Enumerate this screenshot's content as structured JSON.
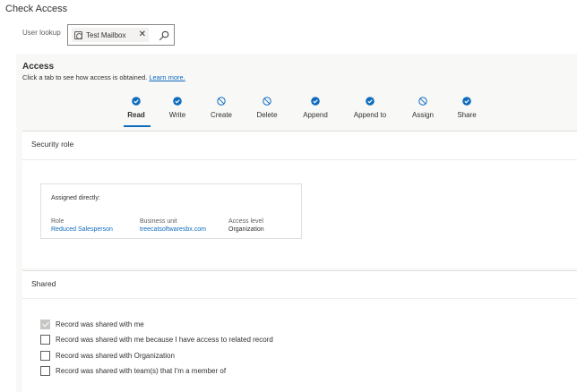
{
  "page_title": "Check Access",
  "user_lookup": {
    "label": "User lookup",
    "selected_value": "Test Mailbox",
    "clear_glyph": "✕",
    "chip_icon": "mailbox-icon",
    "search_icon": "search-icon"
  },
  "access": {
    "title": "Access",
    "description": "Click a tab to see how access is obtained.",
    "learn_more": "Learn more.",
    "active_tab": "Read",
    "tabs": [
      {
        "label": "Read",
        "status": "granted"
      },
      {
        "label": "Write",
        "status": "granted"
      },
      {
        "label": "Create",
        "status": "denied"
      },
      {
        "label": "Delete",
        "status": "denied"
      },
      {
        "label": "Append",
        "status": "granted"
      },
      {
        "label": "Append to",
        "status": "granted"
      },
      {
        "label": "Assign",
        "status": "denied"
      },
      {
        "label": "Share",
        "status": "granted"
      }
    ]
  },
  "security_role": {
    "title": "Security role",
    "assigned_title": "Assigned directly:",
    "columns": {
      "role": "Role",
      "business_unit": "Business unit",
      "access_level": "Access level"
    },
    "row": {
      "role": "Reduced Salesperson",
      "business_unit": "treecatsoftwaresbx.com",
      "access_level": "Organization"
    }
  },
  "shared": {
    "title": "Shared",
    "items": [
      {
        "label": "Record was shared with me",
        "checked": true
      },
      {
        "label": "Record was shared with me because I have access to related record",
        "checked": false
      },
      {
        "label": "Record was shared with Organization",
        "checked": false
      },
      {
        "label": "Record was shared with team(s) that I'm a member of",
        "checked": false
      }
    ]
  },
  "colors": {
    "accent": "#0f6cbd",
    "text": "#323130",
    "panel_bg": "#f8f8f7"
  }
}
